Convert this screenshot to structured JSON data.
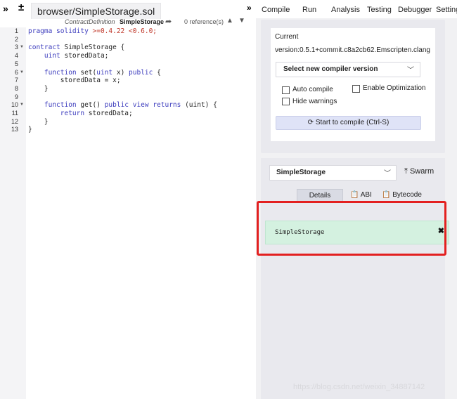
{
  "editor": {
    "file_tab": "browser/SimpleStorage.sol",
    "contract_label": "ContractDefinition",
    "contract_name": "SimpleStorage",
    "references": "0 reference(s)",
    "lines": [
      {
        "no": "1",
        "fold": false,
        "parts": [
          {
            "t": "pragma solidity ",
            "c": "kw"
          },
          {
            "t": ">=0.4.22 <0.6.0;",
            "c": "str"
          }
        ]
      },
      {
        "no": "2",
        "fold": false,
        "parts": []
      },
      {
        "no": "3",
        "fold": true,
        "parts": [
          {
            "t": "contract ",
            "c": "kw"
          },
          {
            "t": "SimpleStorage {",
            "c": ""
          }
        ]
      },
      {
        "no": "4",
        "fold": false,
        "parts": [
          {
            "t": "    uint ",
            "c": "kw"
          },
          {
            "t": "storedData;",
            "c": ""
          }
        ]
      },
      {
        "no": "5",
        "fold": false,
        "parts": []
      },
      {
        "no": "6",
        "fold": true,
        "parts": [
          {
            "t": "    function ",
            "c": "kw"
          },
          {
            "t": "set(",
            "c": ""
          },
          {
            "t": "uint ",
            "c": "kw"
          },
          {
            "t": "x) ",
            "c": ""
          },
          {
            "t": "public ",
            "c": "kw"
          },
          {
            "t": "{",
            "c": ""
          }
        ]
      },
      {
        "no": "7",
        "fold": false,
        "parts": [
          {
            "t": "        storedData = x;",
            "c": ""
          }
        ]
      },
      {
        "no": "8",
        "fold": false,
        "parts": [
          {
            "t": "    }",
            "c": ""
          }
        ]
      },
      {
        "no": "9",
        "fold": false,
        "parts": []
      },
      {
        "no": "10",
        "fold": true,
        "parts": [
          {
            "t": "    function ",
            "c": "kw"
          },
          {
            "t": "get() ",
            "c": ""
          },
          {
            "t": "public view returns ",
            "c": "kw"
          },
          {
            "t": "(uint) {",
            "c": ""
          }
        ]
      },
      {
        "no": "11",
        "fold": false,
        "parts": [
          {
            "t": "        return ",
            "c": "kw"
          },
          {
            "t": "storedData;",
            "c": ""
          }
        ]
      },
      {
        "no": "12",
        "fold": false,
        "parts": [
          {
            "t": "    }",
            "c": ""
          }
        ]
      },
      {
        "no": "13",
        "fold": false,
        "parts": [
          {
            "t": "}",
            "c": ""
          }
        ]
      }
    ]
  },
  "menu": [
    "Compile",
    "Run",
    "Analysis",
    "Testing",
    "Debugger",
    "Setting"
  ],
  "compiler": {
    "current_label": "Current",
    "version": "version:0.5.1+commit.c8a2cb62.Emscripten.clang",
    "select_label": "Select new compiler version",
    "auto_compile": "Auto compile",
    "enable_optimization": "Enable Optimization",
    "hide_warnings": "Hide warnings",
    "compile_button": "Start to compile (Ctrl-S)"
  },
  "contract": {
    "selected": "SimpleStorage",
    "swarm": "Swarm",
    "details": "Details",
    "abi": "ABI",
    "bytecode": "Bytecode",
    "result": "SimpleStorage"
  },
  "watermark": "https://blog.csdn.net/weixin_34887142"
}
